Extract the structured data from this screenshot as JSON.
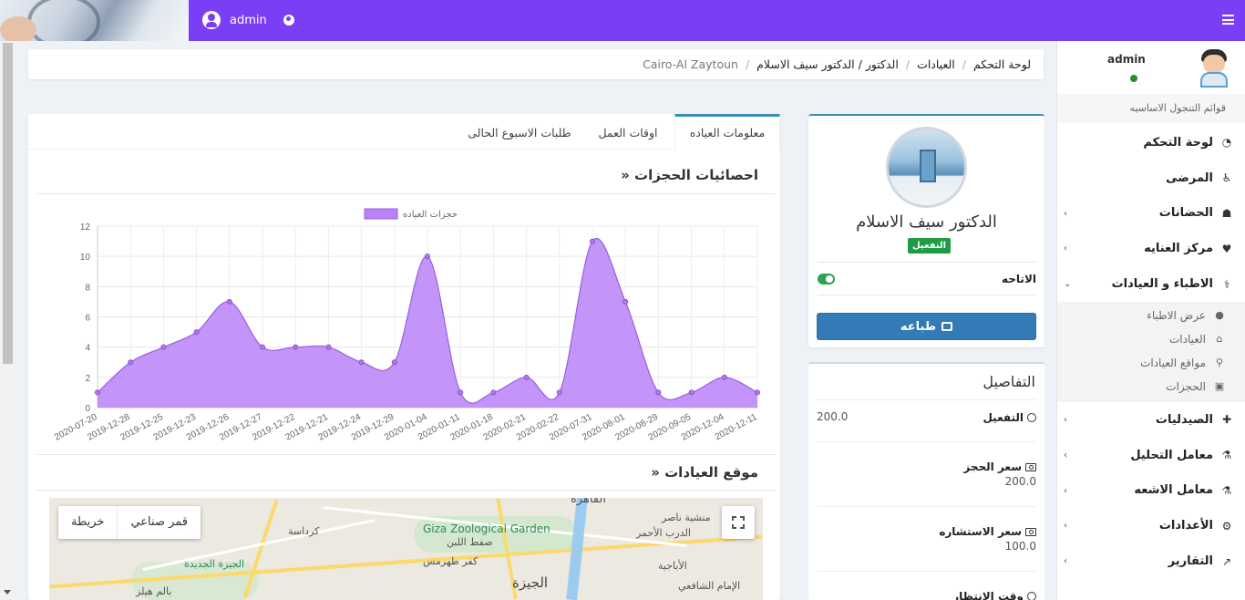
{
  "topbar": {
    "user": "admin"
  },
  "breadcrumb": [
    "لوحة التحكم",
    "العيادات",
    "الدكتور / الدكتور سيف الاسلام",
    "Cairo-Al Zaytoun"
  ],
  "sidebar": {
    "user": "admin",
    "section_title": "قوائم التنجول الاساسيه",
    "items": [
      {
        "label": "لوحة التحكم",
        "icon": "dashboard-icon",
        "chevron": false
      },
      {
        "label": "المرضى",
        "icon": "wheelchair-icon",
        "chevron": false
      },
      {
        "label": "الحضانات",
        "icon": "baby-icon",
        "chevron": true
      },
      {
        "label": "مركز العنايه",
        "icon": "heartbeat-icon",
        "chevron": true
      },
      {
        "label": "الاطباء و العيادات",
        "icon": "doctor-icon",
        "chevron": true,
        "expanded": true
      }
    ],
    "subitems": [
      {
        "label": "عرض الاطباء",
        "icon": "circle-icon"
      },
      {
        "label": "العيادات",
        "icon": "building-icon"
      },
      {
        "label": "مواقع العيادات",
        "icon": "map-marker-icon"
      },
      {
        "label": "الحجزات",
        "icon": "calendar-icon"
      }
    ],
    "items_after": [
      {
        "label": "الصيدليات",
        "icon": "medkit-icon"
      },
      {
        "label": "معامل التحليل",
        "icon": "flask-icon"
      },
      {
        "label": "معامل الاشعه",
        "icon": "xray-icon"
      },
      {
        "label": "الأعدادات",
        "icon": "cogs-icon"
      },
      {
        "label": "التقارير",
        "icon": "chart-icon"
      }
    ]
  },
  "profile": {
    "name": "الدكتور سيف الاسلام",
    "badge": "التفعيل",
    "availability_label": "الاتاحه",
    "print_label": "طباعه"
  },
  "details": {
    "title": "التفاصيل",
    "rows": [
      {
        "label": "التفعيل",
        "value": "200.0"
      },
      {
        "label": "سعر الحجز",
        "value": "200.0"
      },
      {
        "label": "سعر الاستشاره",
        "value": "100.0"
      },
      {
        "label": "وقت الانتظار",
        "value": ""
      }
    ]
  },
  "tabs": [
    "معلومات العياده",
    "اوقات العمل",
    "طلبات الاسبوع الحالى"
  ],
  "stats_title": "» احصائيات الحجزات",
  "map_title": "» موقع العيادات",
  "map": {
    "controls": [
      "قمر صناعي",
      "خريطة"
    ],
    "labels": [
      "Giza Zoological Garden",
      "الجيزة",
      "كرداسة",
      "صفط اللبن",
      "كفر طهرمس",
      "الجيزة الجديدة",
      "بالم هيلز",
      "الإمام الشافعي",
      "الأباجية",
      "الدرب الأحمر",
      "منشية ناصر",
      "القاهرة"
    ]
  },
  "chart_data": {
    "type": "area",
    "series": [
      {
        "name": "حجزات العياده",
        "color": "#b983f7"
      }
    ],
    "x": [
      "2020-07-20",
      "2019-12-28",
      "2019-12-25",
      "2019-12-23",
      "2019-12-26",
      "2019-12-27",
      "2019-12-22",
      "2019-12-21",
      "2019-12-24",
      "2019-12-29",
      "2020-01-04",
      "2020-01-11",
      "2020-01-18",
      "2020-02-21",
      "2020-02-22",
      "2020-07-31",
      "2020-08-01",
      "2020-08-29",
      "2020-09-05",
      "2020-12-04",
      "2020-12-11"
    ],
    "values": [
      1,
      3,
      4,
      5,
      7,
      4,
      4,
      4,
      3,
      3,
      10,
      1,
      1,
      2,
      1,
      11,
      7,
      1,
      1,
      2,
      1
    ],
    "ylim": [
      0,
      12
    ],
    "yticks": [
      0,
      2,
      4,
      6,
      8,
      10,
      12
    ],
    "legend_position": "top-center",
    "grid": true
  }
}
